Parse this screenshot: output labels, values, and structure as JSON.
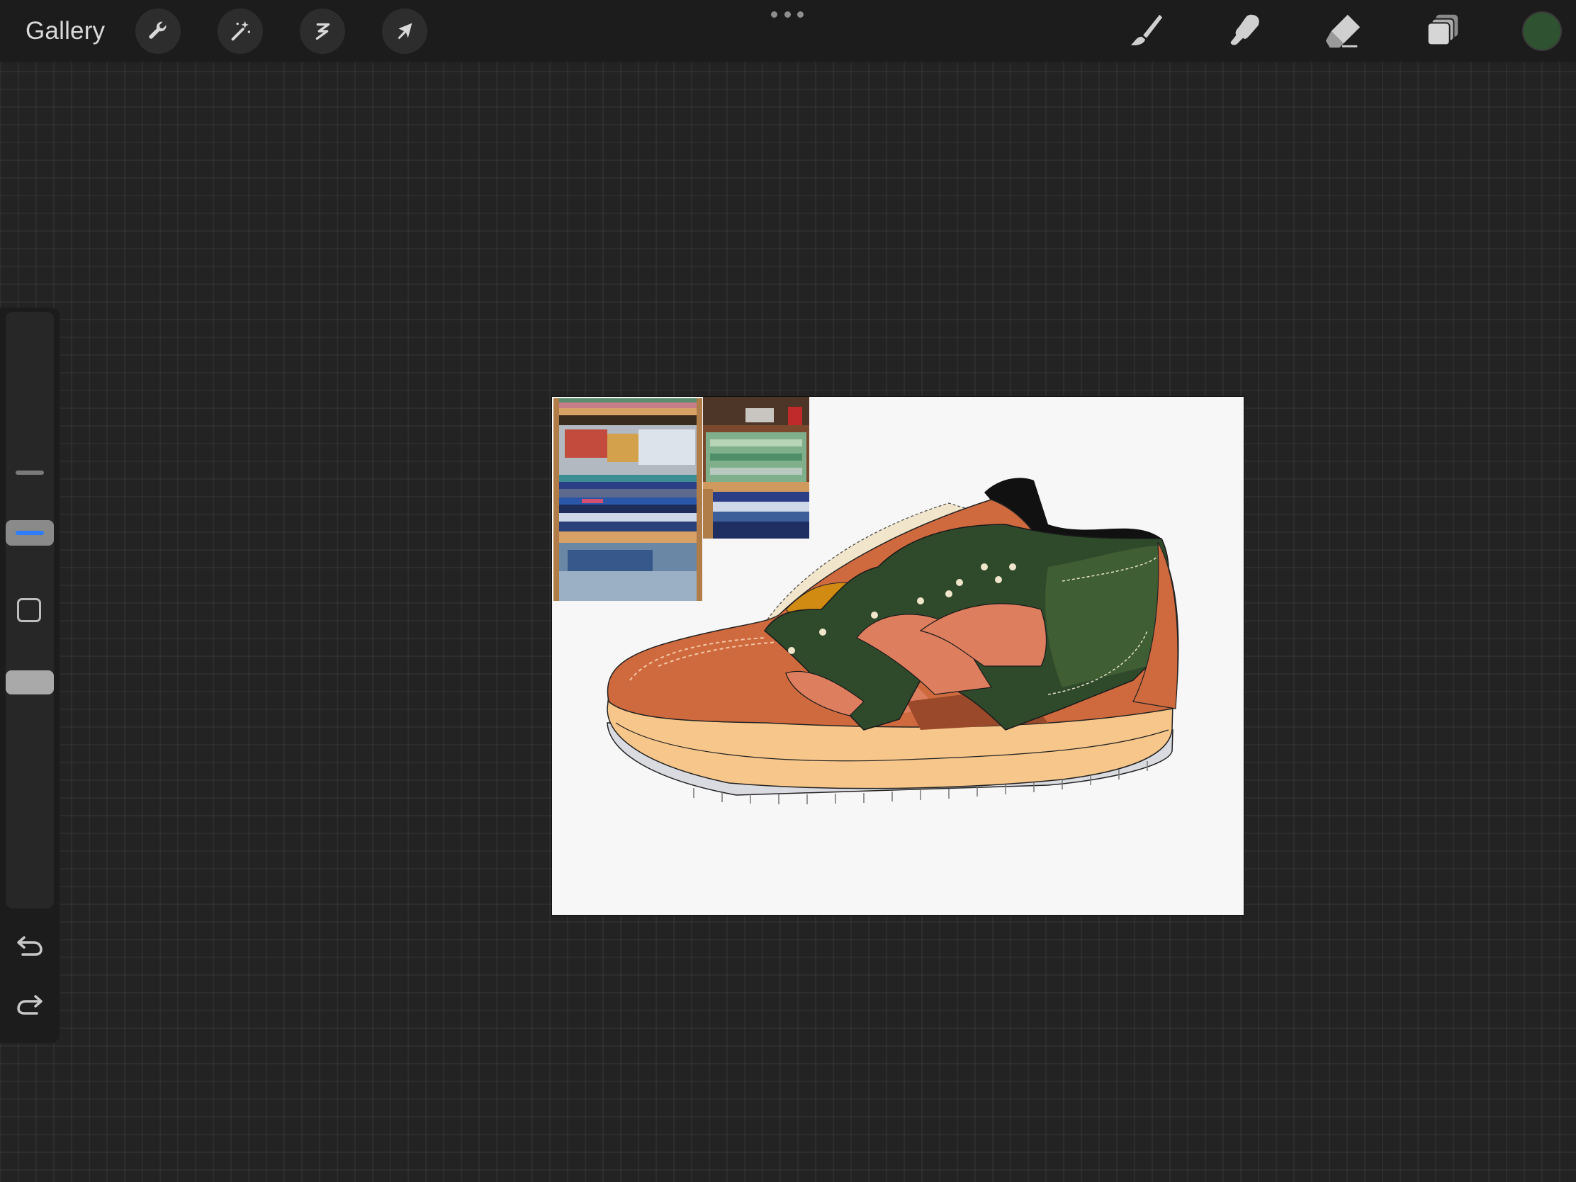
{
  "app": {
    "gallery_label": "Gallery"
  },
  "toolbar": {
    "left_tools": [
      {
        "name": "actions",
        "icon": "wrench-icon"
      },
      {
        "name": "adjustments",
        "icon": "magic-wand-icon"
      },
      {
        "name": "selection",
        "icon": "selection-s-icon"
      },
      {
        "name": "transform",
        "icon": "arrow-cursor-icon"
      }
    ],
    "more_icon": "more-dots-icon",
    "right_tools": [
      {
        "name": "brush",
        "icon": "brush-icon"
      },
      {
        "name": "smudge",
        "icon": "smudge-finger-icon"
      },
      {
        "name": "eraser",
        "icon": "eraser-icon"
      },
      {
        "name": "layers",
        "icon": "layers-icon"
      }
    ],
    "current_color": "#2f5230"
  },
  "sidebar": {
    "brush_size_icon": "brush-size-slider",
    "modify_icon": "square-modify-icon",
    "opacity_icon": "opacity-slider",
    "undo_icon": "undo-arrow-icon",
    "redo_icon": "redo-arrow-icon",
    "accent_color": "#2f7dfa"
  },
  "canvas": {
    "background": "#f7f7f7",
    "content": "sneaker-illustration",
    "reference_images": [
      "folded-blankets-on-shelf-photo",
      "green-blanket-stack-photo"
    ],
    "palette": [
      "#cf6a3e",
      "#2f4a2b",
      "#f6c68a",
      "#dd7e5e",
      "#d18a12",
      "#f1e6cb",
      "#111111",
      "#9a4a2a"
    ]
  }
}
